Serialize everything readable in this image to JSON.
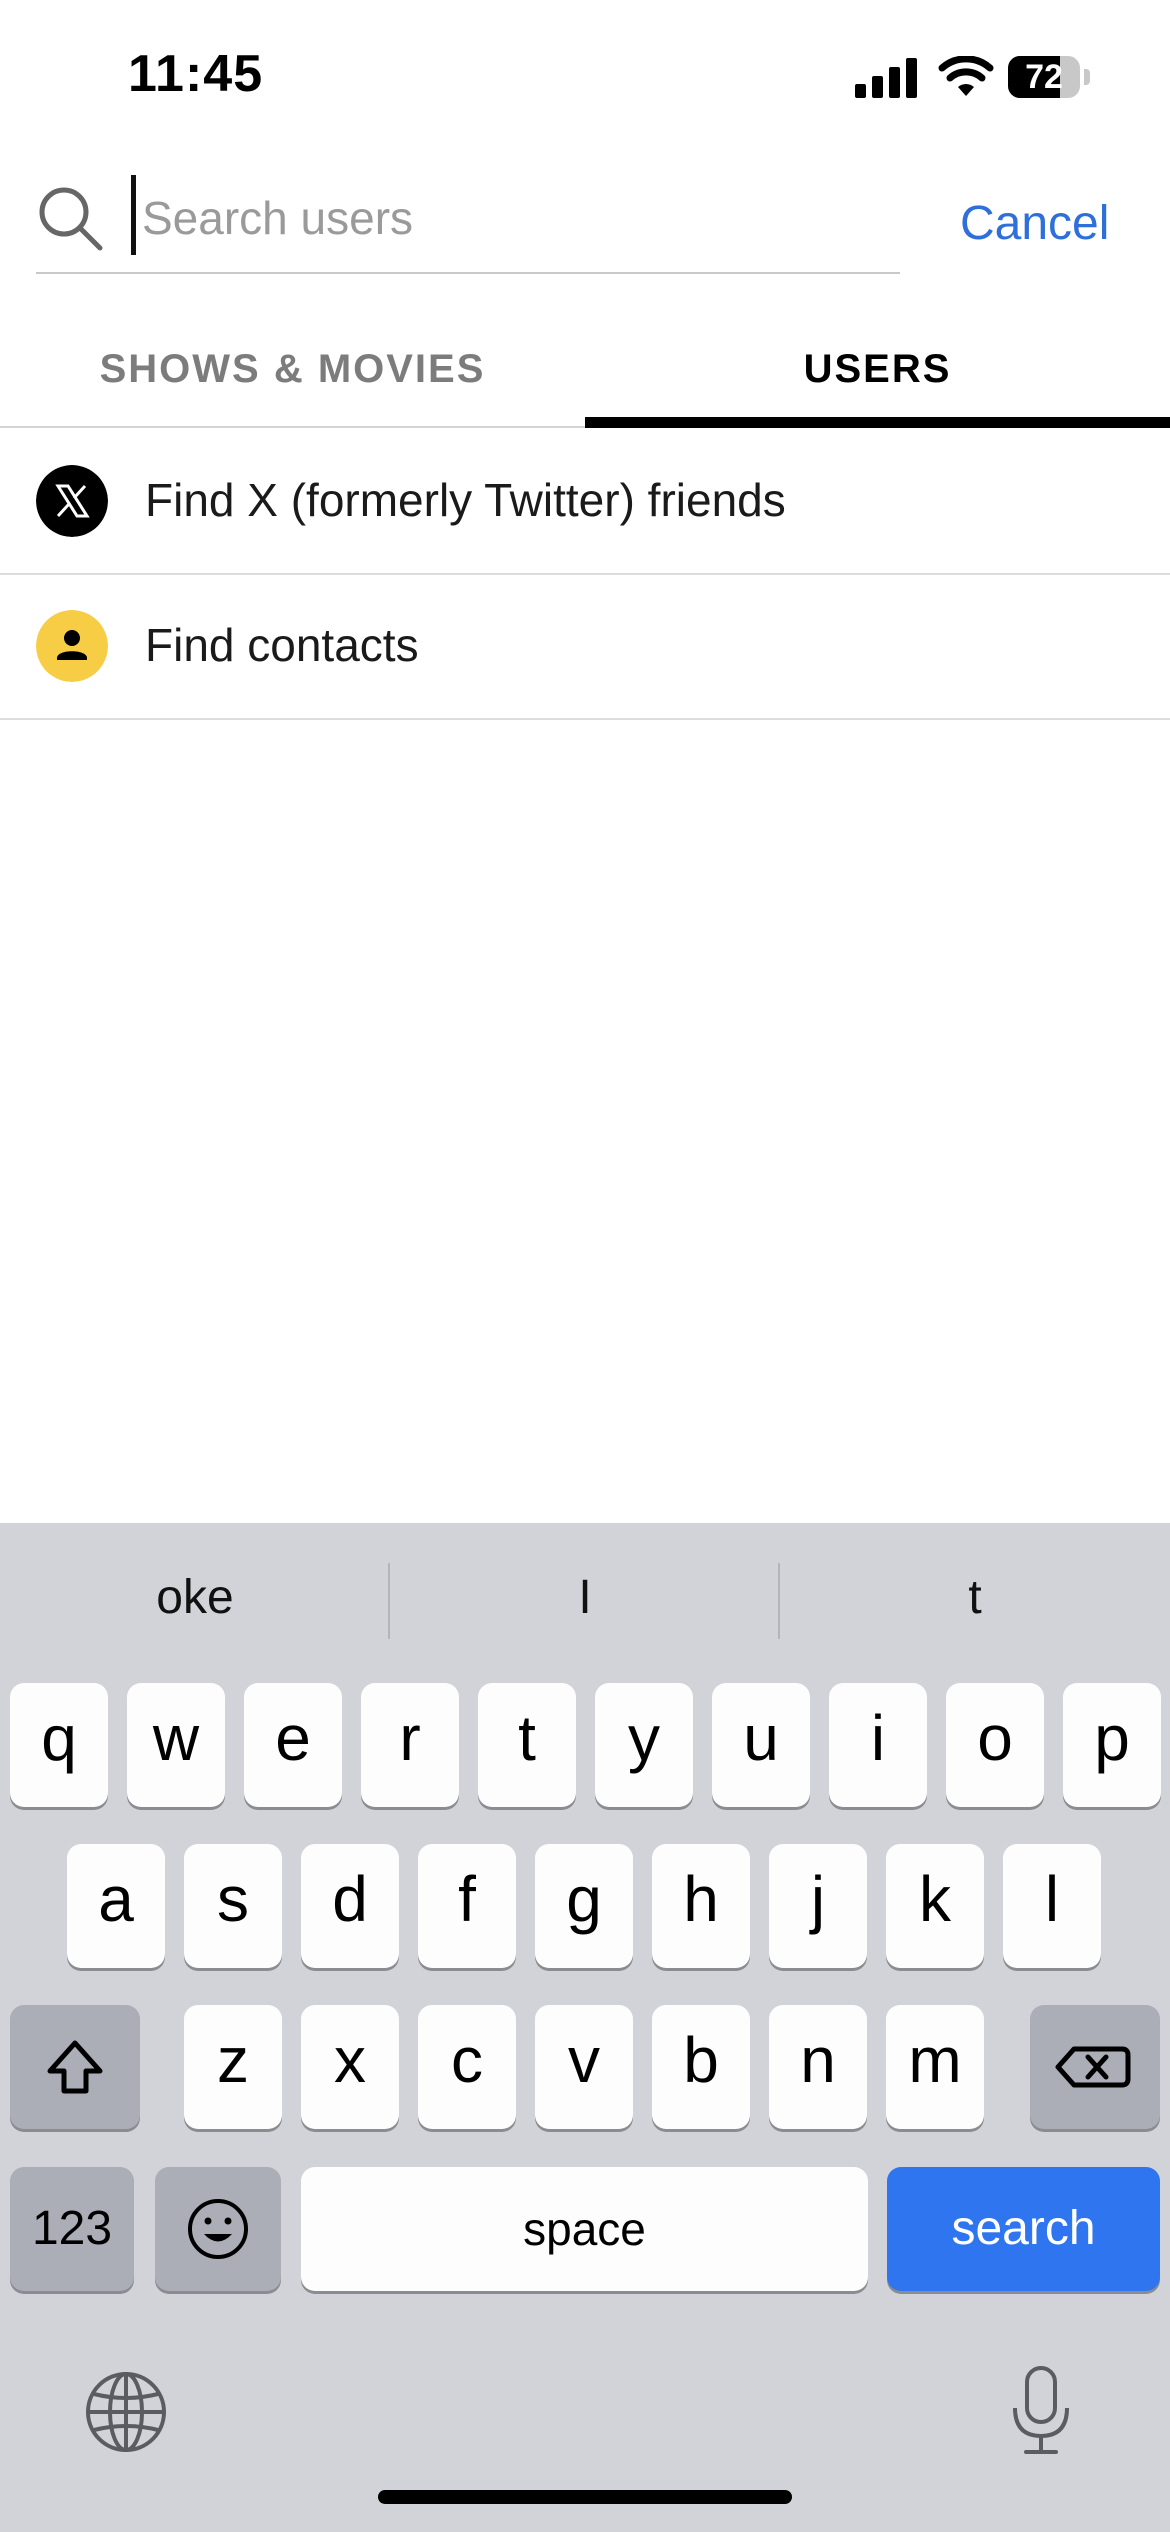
{
  "status_bar": {
    "time": "11:45",
    "battery_percent": 72
  },
  "search": {
    "placeholder": "Search users",
    "value": "",
    "cancel_label": "Cancel"
  },
  "tabs": [
    {
      "label": "SHOWS & MOVIES",
      "active": false
    },
    {
      "label": "USERS",
      "active": true
    }
  ],
  "list": [
    {
      "label": "Find X (formerly Twitter) friends",
      "icon": "x-logo-icon"
    },
    {
      "label": "Find contacts",
      "icon": "person-icon"
    }
  ],
  "colors": {
    "accent": "#2f6fd9",
    "contacts_icon_bg": "#f7cd46",
    "keyboard_bg": "#d1d3d9",
    "search_key": "#2f75f0"
  },
  "keyboard": {
    "suggestions": [
      "oke",
      "I",
      "t"
    ],
    "row1": [
      "q",
      "w",
      "e",
      "r",
      "t",
      "y",
      "u",
      "i",
      "o",
      "p"
    ],
    "row2": [
      "a",
      "s",
      "d",
      "f",
      "g",
      "h",
      "j",
      "k",
      "l"
    ],
    "row3": [
      "z",
      "x",
      "c",
      "v",
      "b",
      "n",
      "m"
    ],
    "numbers_label": "123",
    "space_label": "space",
    "search_label": "search"
  }
}
